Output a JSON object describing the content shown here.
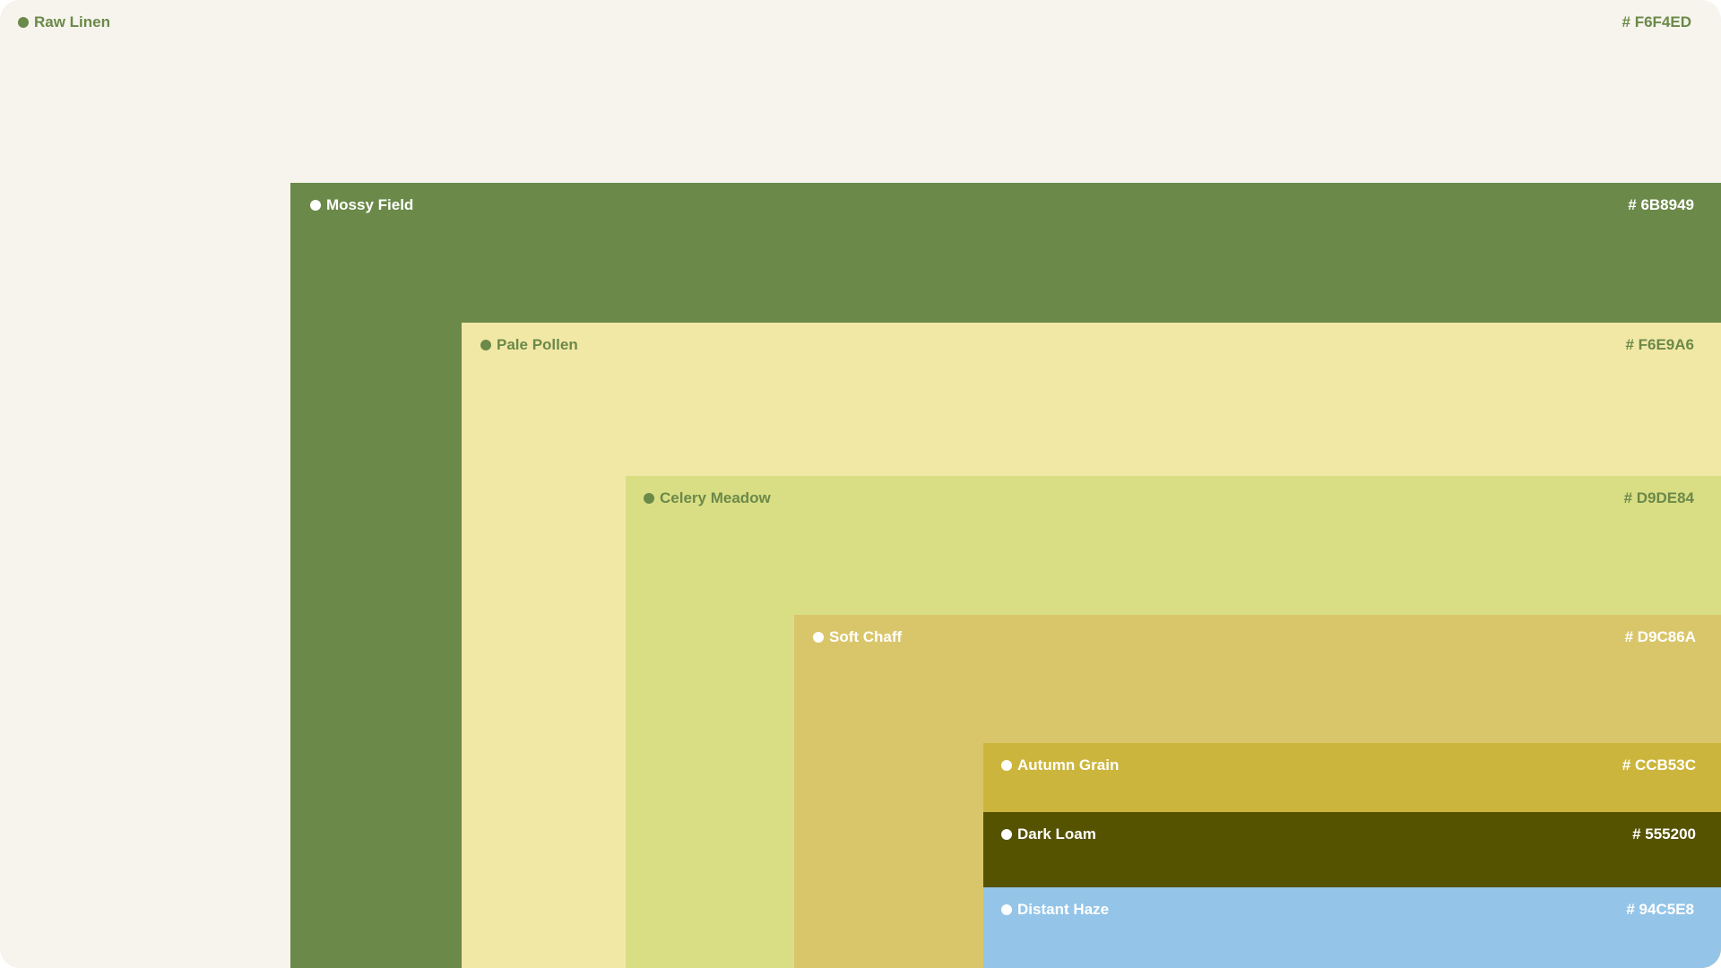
{
  "palette": {
    "swatches": [
      {
        "name": "Raw Linen",
        "hex_label": "# F6F4ED",
        "color": "#F6F4ED",
        "text_color": "#6B8949"
      },
      {
        "name": "Mossy Field",
        "hex_label": "# 6B8949",
        "color": "#6B8949",
        "text_color": "#FFFFFF"
      },
      {
        "name": "Pale Pollen",
        "hex_label": "# F6E9A6",
        "color": "#F2E8A6",
        "text_color": "#6B8949"
      },
      {
        "name": "Celery Meadow",
        "hex_label": "# D9DE84",
        "color": "#D9DE84",
        "text_color": "#6B8949"
      },
      {
        "name": "Soft Chaff",
        "hex_label": "# D9C86A",
        "color": "#D9C66A",
        "text_color": "#FFFFFF"
      },
      {
        "name": "Autumn Grain",
        "hex_label": "# CCB53C",
        "color": "#CCB53C",
        "text_color": "#FFFFFF"
      },
      {
        "name": "Dark Loam",
        "hex_label": "# 555200",
        "color": "#555200",
        "text_color": "#FFFFFF"
      },
      {
        "name": "Distant Haze",
        "hex_label": "# 94C5E8",
        "color": "#94C5E8",
        "text_color": "#FFFFFF"
      }
    ]
  }
}
